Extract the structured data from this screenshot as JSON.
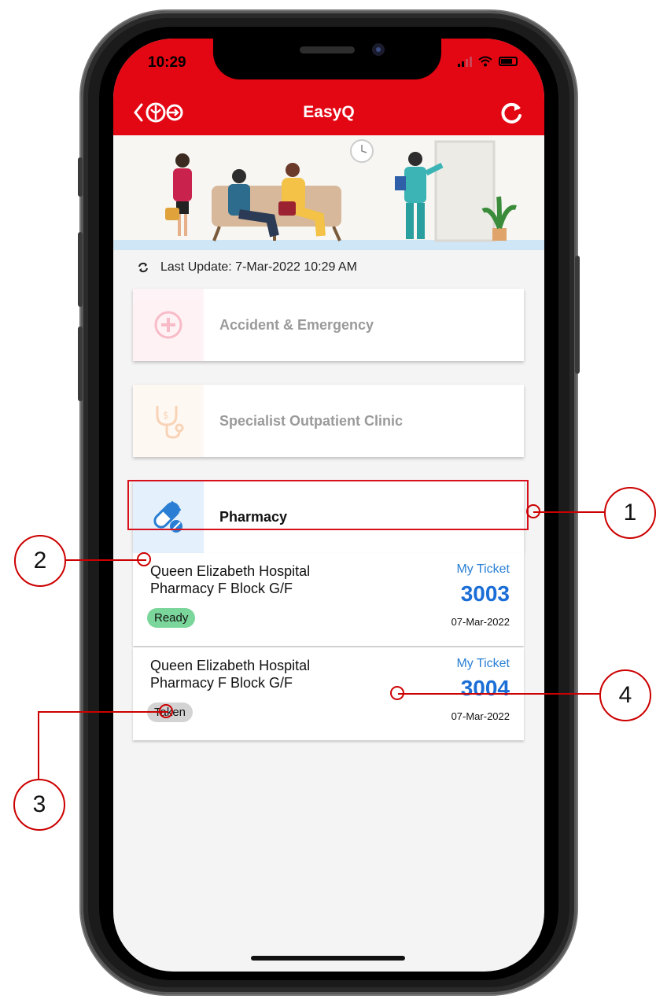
{
  "status_bar": {
    "time": "10:29"
  },
  "app_bar": {
    "title": "EasyQ"
  },
  "last_update": {
    "text": "Last Update: 7-Mar-2022 10:29 AM"
  },
  "services": [
    {
      "label": "Accident & Emergency",
      "icon": "plus-circle-icon",
      "color": "#fde4ea",
      "state": "disabled"
    },
    {
      "label": "Specialist Outpatient Clinic",
      "icon": "stethoscope-icon",
      "color": "#fdf1e6",
      "state": "disabled"
    },
    {
      "label": "Pharmacy",
      "icon": "pill-icon",
      "color": "#e4f0fc",
      "state": "active"
    }
  ],
  "tickets": [
    {
      "hospital": "Queen Elizabeth Hospital",
      "location": "Pharmacy F Block G/F",
      "status": "Ready",
      "status_color": "#7ad69a",
      "ticket_label": "My Ticket",
      "ticket_number": "3003",
      "date": "07-Mar-2022"
    },
    {
      "hospital": "Queen Elizabeth Hospital",
      "location": "Pharmacy F Block G/F",
      "status": "Taken",
      "status_color": "#d3d3d3",
      "ticket_label": "My Ticket",
      "ticket_number": "3004",
      "date": "07-Mar-2022"
    }
  ],
  "annotations": [
    "1",
    "2",
    "3",
    "4"
  ],
  "colors": {
    "brand": "#e30613",
    "ticket_blue": "#1a6ed6"
  }
}
